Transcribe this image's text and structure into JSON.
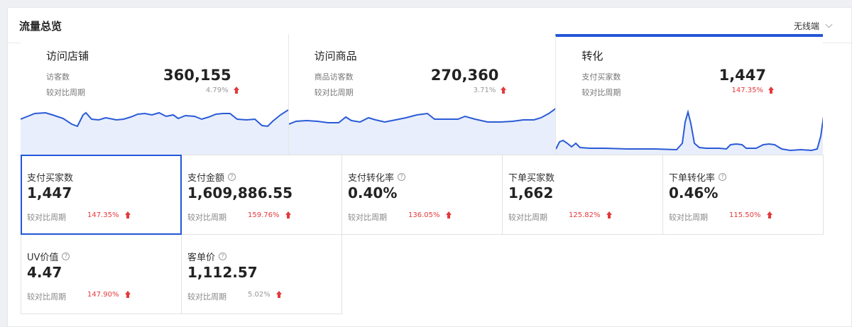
{
  "header": {
    "title": "流量总览",
    "device_selector": "无线端"
  },
  "top_cards": [
    {
      "name": "访问店铺",
      "metric_label": "访客数",
      "value": "360,155",
      "compare_label": "较对比周期",
      "change": "4.79%",
      "direction": "up",
      "active": false
    },
    {
      "name": "访问商品",
      "metric_label": "商品访客数",
      "value": "270,360",
      "compare_label": "较对比周期",
      "change": "3.71%",
      "direction": "up",
      "active": false
    },
    {
      "name": "转化",
      "metric_label": "支付买家数",
      "value": "1,447",
      "compare_label": "较对比周期",
      "change": "147.35%",
      "direction": "up",
      "active": true
    }
  ],
  "metrics": [
    {
      "name": "支付买家数",
      "value": "1,447",
      "compare_label": "较对比周期",
      "change": "147.35%",
      "direction": "up",
      "help": false,
      "selected": true,
      "change_color": "red"
    },
    {
      "name": "支付金额",
      "value": "1,609,886.55",
      "compare_label": "较对比周期",
      "change": "159.76%",
      "direction": "up",
      "help": true,
      "selected": false,
      "change_color": "red"
    },
    {
      "name": "支付转化率",
      "value": "0.40%",
      "compare_label": "较对比周期",
      "change": "136.05%",
      "direction": "up",
      "help": true,
      "selected": false,
      "change_color": "red"
    },
    {
      "name": "下单买家数",
      "value": "1,662",
      "compare_label": "较对比周期",
      "change": "125.82%",
      "direction": "up",
      "help": false,
      "selected": false,
      "change_color": "red"
    },
    {
      "name": "下单转化率",
      "value": "0.46%",
      "compare_label": "较对比周期",
      "change": "115.50%",
      "direction": "up",
      "help": true,
      "selected": false,
      "change_color": "red"
    },
    {
      "name": "UV价值",
      "value": "4.47",
      "compare_label": "较对比周期",
      "change": "147.90%",
      "direction": "up",
      "help": true,
      "selected": false,
      "change_color": "red"
    },
    {
      "name": "客单价",
      "value": "1,112.57",
      "compare_label": "较对比周期",
      "change": "5.02%",
      "direction": "up",
      "help": true,
      "selected": false,
      "change_color": "grey"
    }
  ],
  "icons": {
    "help": "question-circle-icon",
    "trend_up": "arrow-up-icon",
    "dropdown": "chevron-down-icon"
  },
  "colors": {
    "accent": "#2456d6",
    "line": "#2a5bd7",
    "area_fill": "#e8eefb",
    "increase": "#e4393c"
  }
}
